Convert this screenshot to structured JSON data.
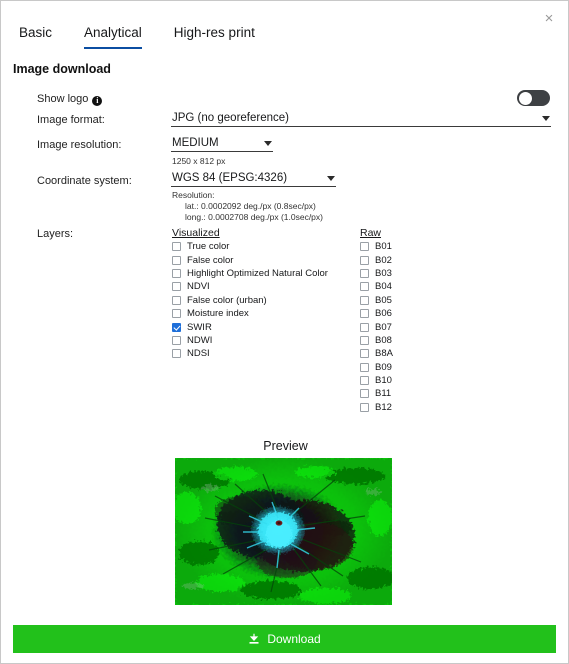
{
  "window": {
    "close_label": "×"
  },
  "tabs": [
    {
      "label": "Basic",
      "active": false
    },
    {
      "label": "Analytical",
      "active": true
    },
    {
      "label": "High-res print",
      "active": false
    }
  ],
  "section": {
    "title": "Image download"
  },
  "form": {
    "show_logo": {
      "label": "Show logo",
      "info_glyph": "i",
      "toggle_state": "off"
    },
    "image_format": {
      "label": "Image format:",
      "value": "JPG (no georeference)"
    },
    "image_resolution": {
      "label": "Image resolution:",
      "value": "MEDIUM",
      "note": "1250 x 812 px"
    },
    "coordinate_system": {
      "label": "Coordinate system:",
      "value": "WGS 84 (EPSG:4326)",
      "resolution_title": "Resolution:",
      "resolution_lat": "lat.: 0.0002092 deg./px (0.8sec/px)",
      "resolution_long": "long.: 0.0002708 deg./px (1.0sec/px)"
    },
    "layers": {
      "label": "Layers:",
      "visualized_header": "Visualized",
      "raw_header": "Raw",
      "visualized": [
        {
          "label": "True color",
          "checked": false
        },
        {
          "label": "False color",
          "checked": false
        },
        {
          "label": "Highlight Optimized Natural Color",
          "checked": false
        },
        {
          "label": "NDVI",
          "checked": false
        },
        {
          "label": "False color (urban)",
          "checked": false
        },
        {
          "label": "Moisture index",
          "checked": false
        },
        {
          "label": "SWIR",
          "checked": true
        },
        {
          "label": "NDWI",
          "checked": false
        },
        {
          "label": "NDSI",
          "checked": false
        }
      ],
      "raw": [
        {
          "label": "B01",
          "checked": false
        },
        {
          "label": "B02",
          "checked": false
        },
        {
          "label": "B03",
          "checked": false
        },
        {
          "label": "B04",
          "checked": false
        },
        {
          "label": "B05",
          "checked": false
        },
        {
          "label": "B06",
          "checked": false
        },
        {
          "label": "B07",
          "checked": false
        },
        {
          "label": "B08",
          "checked": false
        },
        {
          "label": "B8A",
          "checked": false
        },
        {
          "label": "B09",
          "checked": false
        },
        {
          "label": "B10",
          "checked": false
        },
        {
          "label": "B11",
          "checked": false
        },
        {
          "label": "B12",
          "checked": false
        }
      ]
    }
  },
  "preview": {
    "title": "Preview"
  },
  "download": {
    "label": "Download"
  },
  "colors": {
    "accent_tab": "#0b4ea2",
    "checkbox_checked": "#1e6fd9",
    "download_button": "#22c11b",
    "toggle_track_off": "#3e4144"
  }
}
